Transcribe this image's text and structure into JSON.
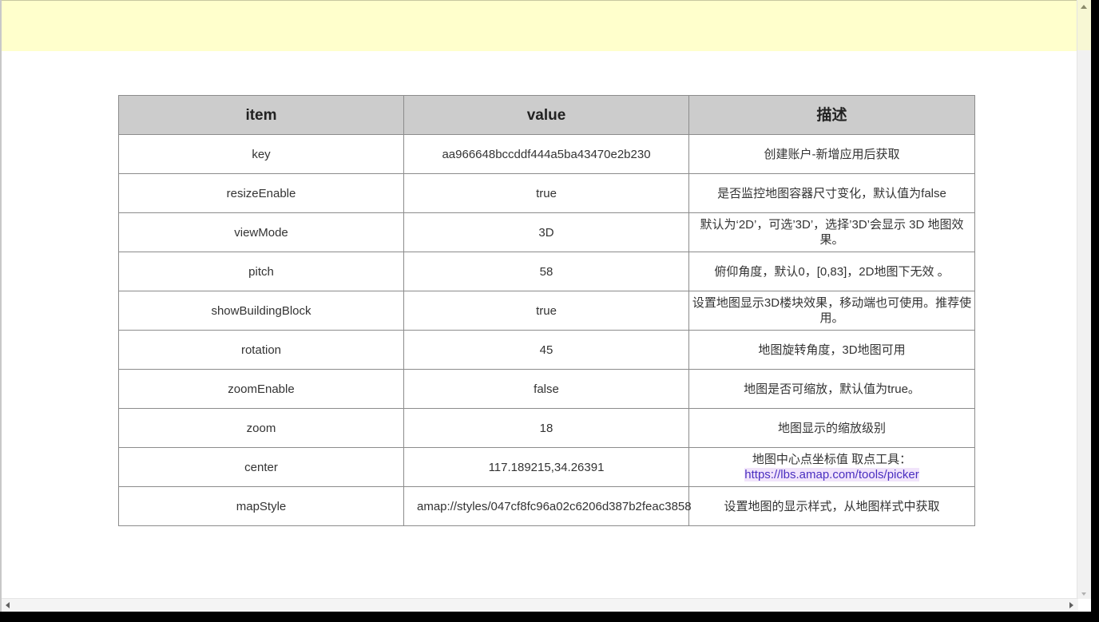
{
  "table": {
    "headers": [
      "item",
      "value",
      "描述"
    ],
    "rows": [
      {
        "item": "key",
        "value": "aa966648bccddf444a5ba43470e2b230",
        "desc": "创建账户-新增应用后获取"
      },
      {
        "item": "resizeEnable",
        "value": "true",
        "desc": "是否监控地图容器尺寸变化，默认值为false"
      },
      {
        "item": "viewMode",
        "value": "3D",
        "desc": "默认为‘2D’，可选’3D’，选择’3D’会显示 3D 地图效果。"
      },
      {
        "item": "pitch",
        "value": "58",
        "desc": "俯仰角度，默认0，[0,83]，2D地图下无效 。"
      },
      {
        "item": "showBuildingBlock",
        "value": "true",
        "desc": "设置地图显示3D楼块效果，移动端也可使用。推荐使用。"
      },
      {
        "item": "rotation",
        "value": "45",
        "desc": "地图旋转角度，3D地图可用"
      },
      {
        "item": "zoomEnable",
        "value": "false",
        "desc": "地图是否可缩放，默认值为true。"
      },
      {
        "item": "zoom",
        "value": "18",
        "desc": "地图显示的缩放级别"
      },
      {
        "item": "center",
        "value": "117.189215,34.26391",
        "desc": "地图中心点坐标值 取点工具：",
        "desc_link": "https://lbs.amap.com/tools/picker"
      },
      {
        "item": "mapStyle",
        "value": "amap://styles/047cf8fc96a02c6206d387b2feac3858",
        "desc": "设置地图的显示样式，从地图样式中获取"
      }
    ]
  },
  "colors": {
    "banner": "#ffffcc",
    "header_bg": "#cccccc",
    "border": "#8c8c8c",
    "link": "#4a2fc0",
    "link_highlight": "#f1e4fb"
  }
}
